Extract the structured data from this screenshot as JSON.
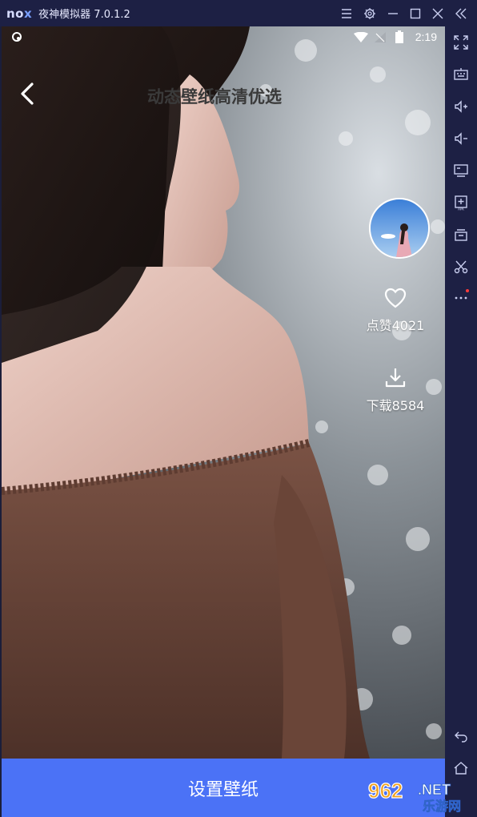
{
  "emulator": {
    "logo": "nox",
    "title": "夜神模拟器 7.0.1.2"
  },
  "status_bar": {
    "time": "2:19"
  },
  "header": {
    "title": "动态壁纸高清优选"
  },
  "actions": {
    "like_label": "点赞4021",
    "download_label": "下载8584"
  },
  "footer": {
    "set_wallpaper_label": "设置壁纸"
  },
  "watermark": {
    "number": "962",
    "suffix": ".NET",
    "text": "乐游网"
  },
  "colors": {
    "accent": "#4b72f6",
    "chrome": "#1d2044"
  }
}
